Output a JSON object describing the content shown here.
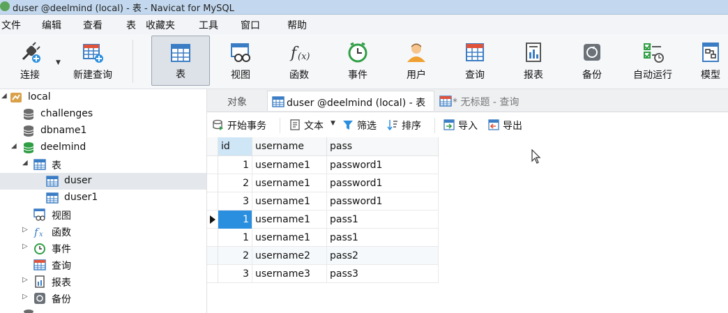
{
  "window": {
    "title": "duser @deelmind (local) - 表 - Navicat for MySQL"
  },
  "menu": [
    "文件",
    "编辑",
    "查看",
    "表",
    "收藏夹",
    "工具",
    "窗口",
    "帮助"
  ],
  "toolbar": {
    "connect": "连接",
    "new_query": "新建查询",
    "table": "表",
    "view": "视图",
    "function": "函数",
    "event": "事件",
    "user": "用户",
    "query": "查询",
    "report": "报表",
    "backup": "备份",
    "automation": "自动运行",
    "model": "模型"
  },
  "tree": {
    "local": "local",
    "challenges": "challenges",
    "dbname1": "dbname1",
    "deelmind": "deelmind",
    "tables": "表",
    "duser": "duser",
    "duser1": "duser1",
    "views": "视图",
    "functions": "函数",
    "events": "事件",
    "queries": "查询",
    "reports": "报表",
    "backups": "备份"
  },
  "tabs": {
    "objects": "对象",
    "duser_tab": "duser @deelmind (local) - 表",
    "untitled_query": "* 无标题 - 查询"
  },
  "subtoolbar": {
    "begin_transaction": "开始事务",
    "text": "文本",
    "filter": "筛选",
    "sort": "排序",
    "import": "导入",
    "export": "导出"
  },
  "grid": {
    "columns": [
      "id",
      "username",
      "pass"
    ],
    "rows": [
      [
        "1",
        "username1",
        "password1"
      ],
      [
        "2",
        "username1",
        "password1"
      ],
      [
        "3",
        "username1",
        "password1"
      ],
      [
        "1",
        "username1",
        "pass1"
      ],
      [
        "1",
        "username1",
        "pass1"
      ],
      [
        "2",
        "username2",
        "pass2"
      ],
      [
        "3",
        "username3",
        "pass3"
      ]
    ]
  },
  "colors": {
    "accent": "#2b8fe0",
    "titlebar": "#c3d8ee",
    "db_open": "#2f9e44"
  }
}
